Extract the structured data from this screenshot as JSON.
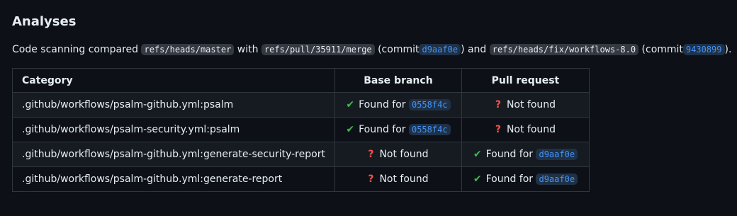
{
  "title": "Analyses",
  "summary": {
    "prefix": "Code scanning compared",
    "base_ref": "refs/heads/master",
    "with_text": "with",
    "head_ref": "refs/pull/35911/merge",
    "commit_open_1": "(commit",
    "commit_1": "d9aaf0e",
    "and_text": ") and",
    "third_ref": "refs/heads/fix/workflows-8.0",
    "commit_open_2": "(commit",
    "commit_2": "9430899",
    "suffix": ")."
  },
  "table": {
    "headers": {
      "category": "Category",
      "base": "Base branch",
      "pr": "Pull request"
    },
    "rows": [
      {
        "category": ".github/workflows/psalm-github.yml:psalm",
        "base": {
          "status": "found",
          "text": "Found for",
          "commit": "0558f4c"
        },
        "pr": {
          "status": "not_found",
          "text": "Not found"
        }
      },
      {
        "category": ".github/workflows/psalm-security.yml:psalm",
        "base": {
          "status": "found",
          "text": "Found for",
          "commit": "0558f4c"
        },
        "pr": {
          "status": "not_found",
          "text": "Not found"
        }
      },
      {
        "category": ".github/workflows/psalm-github.yml:generate-security-report",
        "base": {
          "status": "not_found",
          "text": "Not found"
        },
        "pr": {
          "status": "found",
          "text": "Found for",
          "commit": "d9aaf0e"
        }
      },
      {
        "category": ".github/workflows/psalm-github.yml:generate-report",
        "base": {
          "status": "not_found",
          "text": "Not found"
        },
        "pr": {
          "status": "found",
          "text": "Found for",
          "commit": "d9aaf0e"
        }
      }
    ]
  },
  "icons": {
    "found": "check-icon",
    "not_found": "question-icon"
  },
  "colors": {
    "background": "#0d1117",
    "text": "#e6edf3",
    "border": "#30363d",
    "link": "#4493f8",
    "check": "#3fb950",
    "question": "#f85149"
  }
}
